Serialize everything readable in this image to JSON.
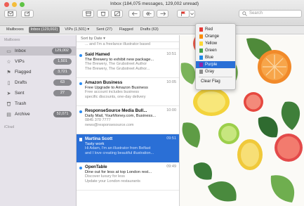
{
  "window": {
    "title": "Inbox (184,075 messages, 129,002 unread)"
  },
  "toolbar": {
    "search_placeholder": "Search",
    "flag_color": "#e0362c"
  },
  "favorites": [
    {
      "label": "Mailboxes"
    },
    {
      "label": "Inbox (129,002)",
      "selected": true
    },
    {
      "label": "VIPs (1,501) ▾"
    },
    {
      "label": "Sent (27)"
    },
    {
      "label": "Flagged"
    },
    {
      "label": "Drafts (63)"
    }
  ],
  "sidebar": {
    "section_mailboxes": "Mailboxes",
    "section_icloud": "iCloud",
    "items": [
      {
        "icon": "inbox-icon",
        "glyph": "▭",
        "label": "Inbox",
        "badge": "129,002",
        "selected": true
      },
      {
        "icon": "star-icon",
        "glyph": "☆",
        "label": "VIPs",
        "badge": "1,501"
      },
      {
        "icon": "flag-icon",
        "glyph": "⚑",
        "label": "Flagged",
        "badge": "3,721"
      },
      {
        "icon": "document-icon",
        "glyph": "▯",
        "label": "Drafts",
        "badge": "63"
      },
      {
        "icon": "paper-plane-icon",
        "glyph": "➤",
        "label": "Sent",
        "badge": "27"
      },
      {
        "icon": "trash-icon",
        "glyph": "🗑",
        "label": "Trash",
        "badge": ""
      },
      {
        "icon": "archive-icon",
        "glyph": "▤",
        "label": "Archive",
        "badge": "52,071"
      }
    ]
  },
  "list": {
    "sort_label": "Sort by Date ▾",
    "messages": [
      {
        "from": "",
        "time": "",
        "subject": "",
        "preview1": "... and I'm a freelance illustrator based",
        "preview2": "",
        "unread": false,
        "selected": false
      },
      {
        "from": "Said Hamed",
        "time": "10:51",
        "subject": "The Brewery to exhibit new package...",
        "preview1": "The Brewery, The Grubstreet Author",
        "preview2": "The Brewery, The Grubstreet Author...",
        "unread": true,
        "selected": false
      },
      {
        "from": "Amazon Business",
        "time": "10:05",
        "subject": "Free Upgrade to Amazon Business",
        "preview1": "Free account includes business",
        "preview2": "specific discounts, one-day delivery",
        "unread": true,
        "selected": false
      },
      {
        "from": "ResponseSource Media Bull...",
        "time": "10:00",
        "subject": "Daily Mail, YourMoney.com, Business...",
        "preview1": "0845 370 7777",
        "preview2": "news@responsesource.com",
        "unread": true,
        "selected": false
      },
      {
        "from": "Martina Scott",
        "time": "09:51",
        "subject": "Tasty work",
        "preview1": "Hi Adam, I'm an illustrator from Belfast",
        "preview2": "and I love creating beautiful illustration...",
        "unread": false,
        "selected": true
      },
      {
        "from": "OpenTable",
        "time": "09:49",
        "subject": "Dine out for less at top London rest...",
        "preview1": "Discover luxury for less",
        "preview2": "Update your London restaurants",
        "unread": true,
        "selected": false
      }
    ]
  },
  "flag_menu": {
    "items": [
      {
        "label": "Red",
        "color": "#e53935"
      },
      {
        "label": "Orange",
        "color": "#fb8c00"
      },
      {
        "label": "Yellow",
        "color": "#fdd835"
      },
      {
        "label": "Green",
        "color": "#43a047"
      },
      {
        "label": "Blue",
        "color": "#1e88e5"
      },
      {
        "label": "Purple",
        "color": "#8e24aa",
        "selected": true
      },
      {
        "label": "Gray",
        "color": "#8d8d8d"
      }
    ],
    "clear_label": "Clear Flag"
  }
}
